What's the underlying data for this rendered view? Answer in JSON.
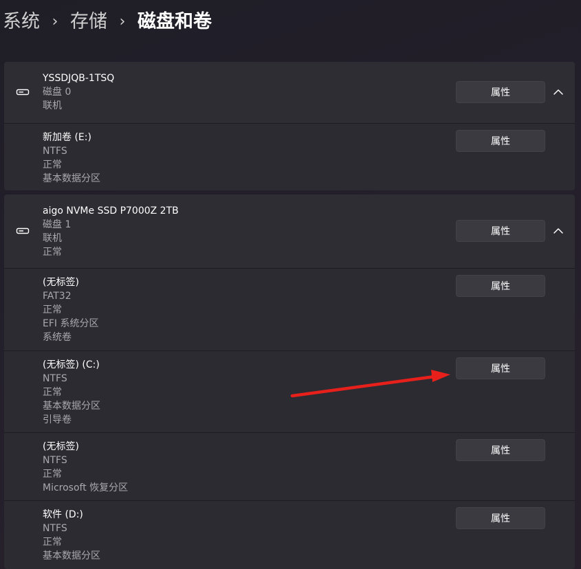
{
  "breadcrumb": {
    "items": [
      "系统",
      "存储",
      "磁盘和卷"
    ],
    "separator": "›"
  },
  "properties_label": "属性",
  "disks": [
    {
      "name": "YSSDJQB-1TSQ",
      "details": [
        "磁盘 0",
        "联机"
      ],
      "volumes": [
        {
          "name": "新加卷 (E:)",
          "details": [
            "NTFS",
            "正常",
            "基本数据分区"
          ]
        }
      ]
    },
    {
      "name": "aigo NVMe SSD P7000Z 2TB",
      "details": [
        "磁盘 1",
        "联机",
        "正常"
      ],
      "volumes": [
        {
          "name": "(无标签)",
          "details": [
            "FAT32",
            "正常",
            "EFI 系统分区",
            "系统卷"
          ]
        },
        {
          "name": "(无标签) (C:)",
          "details": [
            "NTFS",
            "正常",
            "基本数据分区",
            "引导卷"
          ]
        },
        {
          "name": "(无标签)",
          "details": [
            "NTFS",
            "正常",
            "Microsoft 恢复分区"
          ]
        },
        {
          "name": "软件 (D:)",
          "details": [
            "NTFS",
            "正常",
            "基本数据分区"
          ]
        }
      ]
    }
  ],
  "colors": {
    "annotation_arrow": "#e8201c"
  },
  "icons": {
    "disk": "hard-drive-icon",
    "collapse": "chevron-up-icon"
  }
}
